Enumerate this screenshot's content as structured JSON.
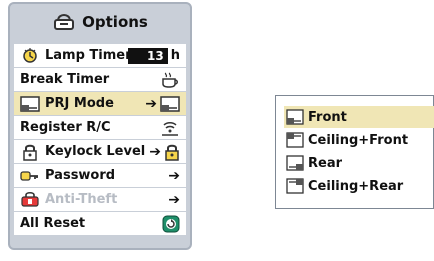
{
  "options_menu": {
    "title": "Options",
    "items": [
      {
        "label": "Lamp Timer",
        "value": "13",
        "unit": "h"
      },
      {
        "label": "Break Timer"
      },
      {
        "label": "PRJ Mode"
      },
      {
        "label": "Register R/C"
      },
      {
        "label": "Keylock Level"
      },
      {
        "label": "Password"
      },
      {
        "label": "Anti-Theft"
      },
      {
        "label": "All Reset"
      }
    ],
    "right_arrows": [
      "➔",
      "➔",
      "➔",
      "➔"
    ]
  },
  "prj_submenu": {
    "items": [
      {
        "label": "Front"
      },
      {
        "label": "Ceiling+Front"
      },
      {
        "label": "Rear"
      },
      {
        "label": "Ceiling+Rear"
      }
    ]
  },
  "colors": {
    "menu_bg": "#c9cfd8",
    "selected": "#f0e6b5",
    "disabled_text": "#b7bcc4"
  }
}
